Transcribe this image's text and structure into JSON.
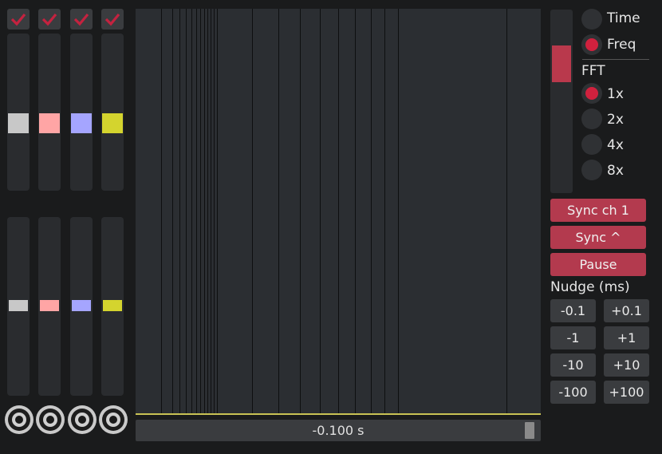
{
  "channels": [
    {
      "enabled": true,
      "color": "#c8c8c8"
    },
    {
      "enabled": true,
      "color": "#ffa5a5"
    },
    {
      "enabled": true,
      "color": "#a5a5ff"
    },
    {
      "enabled": true,
      "color": "#d4d42e"
    }
  ],
  "plot": {
    "scroll_time": "-0.100 s",
    "trace_color": "#c8c254"
  },
  "mode": {
    "time_label": "Time",
    "freq_label": "Freq",
    "selected": "Freq"
  },
  "fft": {
    "title": "FFT",
    "options": [
      "1x",
      "2x",
      "4x",
      "8x"
    ],
    "selected": "1x"
  },
  "buttons": {
    "sync_ch1": "Sync ch 1",
    "sync_edge": "Sync ^",
    "pause": "Pause"
  },
  "nudge": {
    "title": "Nudge (ms)",
    "minus": [
      "-0.1",
      "-1",
      "-10",
      "-100"
    ],
    "plus": [
      "+0.1",
      "+1",
      "+10",
      "+100"
    ]
  },
  "colors": {
    "accent": "#b33a4e",
    "radio_on": "#d0213e",
    "check": "#c4223f"
  }
}
